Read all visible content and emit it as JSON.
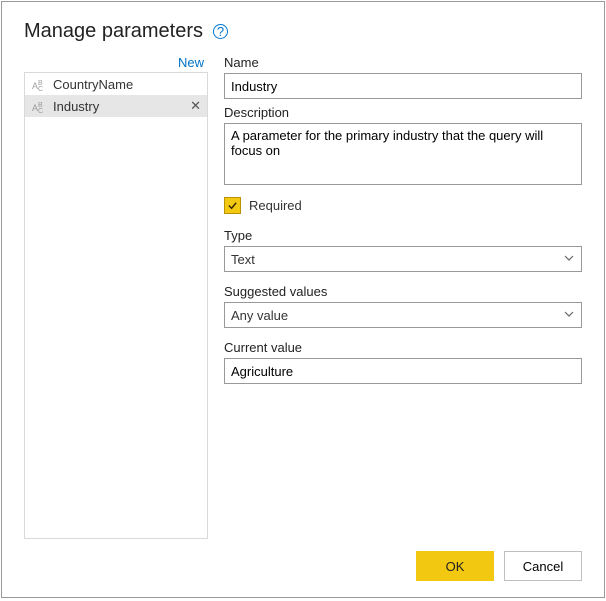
{
  "dialog": {
    "title": "Manage parameters"
  },
  "sidebar": {
    "new_label": "New",
    "items": [
      {
        "label": "CountryName"
      },
      {
        "label": "Industry"
      }
    ]
  },
  "form": {
    "name_label": "Name",
    "name_value": "Industry",
    "description_label": "Description",
    "description_value": "A parameter for the primary industry that the query will focus on",
    "required_label": "Required",
    "type_label": "Type",
    "type_value": "Text",
    "suggested_label": "Suggested values",
    "suggested_value": "Any value",
    "current_label": "Current value",
    "current_value": "Agriculture"
  },
  "footer": {
    "ok_label": "OK",
    "cancel_label": "Cancel"
  }
}
